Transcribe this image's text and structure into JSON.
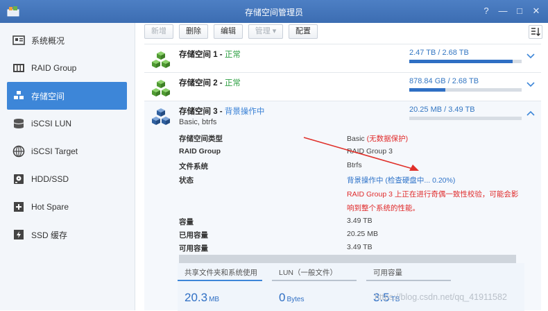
{
  "window": {
    "title": "存储空间管理员",
    "buttons": {
      "help": "?",
      "minimize": "—",
      "maximize": "□",
      "close": "✕"
    }
  },
  "sidebar": {
    "items": [
      {
        "label": "系统概况",
        "icon": "overview-icon"
      },
      {
        "label": "RAID Group",
        "icon": "raid-group-icon"
      },
      {
        "label": "存储空间",
        "icon": "storage-volume-icon",
        "active": true
      },
      {
        "label": "iSCSI LUN",
        "icon": "iscsi-lun-icon"
      },
      {
        "label": "iSCSI Target",
        "icon": "iscsi-target-icon"
      },
      {
        "label": "HDD/SSD",
        "icon": "hdd-icon"
      },
      {
        "label": "Hot Spare",
        "icon": "hot-spare-icon"
      },
      {
        "label": "SSD 缓存",
        "icon": "ssd-cache-icon"
      }
    ]
  },
  "toolbar": {
    "new": "新增",
    "delete": "删除",
    "edit": "编辑",
    "manage": "管理 ▾",
    "config": "配置"
  },
  "volumes": [
    {
      "name": "存储空间 1",
      "sep": " - ",
      "status": "正常",
      "usage": "2.47 TB / 2.68 TB",
      "fill": 0.92
    },
    {
      "name": "存储空间 2",
      "sep": " - ",
      "status": "正常",
      "usage": "878.84 GB / 2.68 TB",
      "fill": 0.32
    },
    {
      "name": "存储空间 3",
      "sep": " - ",
      "status": "背景操作中",
      "sub": "Basic, btrfs",
      "usage": "20.25 MB / 3.49 TB",
      "fill": 0.0
    }
  ],
  "details": {
    "labels": {
      "type": "存储空间类型",
      "raid": "RAID Group",
      "fs": "文件系统",
      "status": "状态",
      "capacity": "容量",
      "used": "已用容量",
      "available": "可用容量"
    },
    "values": {
      "type_main": "Basic",
      "type_note": " (无数据保护)",
      "raid": "RAID Group 3",
      "fs": "Btrfs",
      "status": "背景操作中 (检查硬盘中... 0.20%)",
      "status_note_1": "RAID Group 3 上正在进行奇偶一致性校验，可能会影",
      "status_note_2": "响到整个系统的性能。",
      "capacity": "3.49 TB",
      "used": "20.25 MB",
      "available": "3.49 TB"
    }
  },
  "stats": [
    {
      "label": "共享文件夹和系统使用",
      "value": "20.3",
      "unit": "MB"
    },
    {
      "label": "LUN（一般文件）",
      "value": "0",
      "unit": "Bytes"
    },
    {
      "label": "可用容量",
      "value": "3.5",
      "unit": "TB"
    }
  ],
  "watermark": "https://blog.csdn.net/qq_41911582",
  "colors": {
    "accent": "#3d86d8",
    "ok": "#2ea043",
    "warning": "#e02b2b"
  }
}
